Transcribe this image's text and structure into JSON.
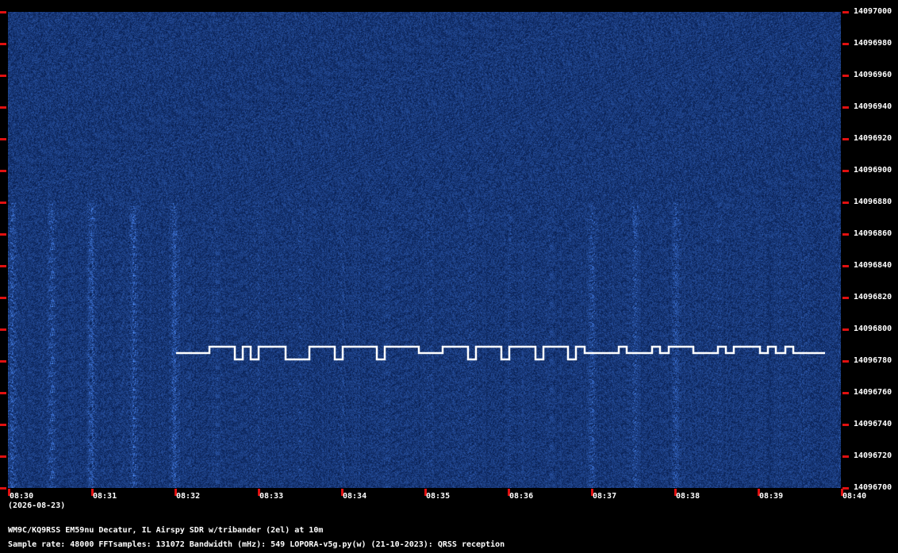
{
  "header_title": "",
  "frequency_axis": {
    "labels": [
      "14097000",
      "14096980",
      "14096960",
      "14096940",
      "14096920",
      "14096900",
      "14096880",
      "14096860",
      "14096840",
      "14096820",
      "14096800",
      "14096780",
      "14096760",
      "14096740",
      "14096720",
      "14096700"
    ],
    "max_hz": 14097000,
    "min_hz": 14096700
  },
  "time_axis": {
    "labels": [
      "08:30",
      "08:31",
      "08:32",
      "08:33",
      "08:34",
      "08:35",
      "08:36",
      "08:37",
      "08:38",
      "08:39",
      "08:40"
    ],
    "date": "(2026-08-23)"
  },
  "station_line": "WM9C/KQ9RSS EM59nu Decatur, IL  Airspy SDR w/tribander (2el) at 10m",
  "params_line": "Sample rate: 48000   FFTsamples: 131072   Bandwidth (mHz): 549       LOPORA-v5g.py(w) (21-10-2023): QRSS reception",
  "colors": {
    "background": "#000000",
    "waterfall_bg": "#071d4e",
    "tick_red": "#e01010",
    "trace_white": "#ffffff"
  }
}
